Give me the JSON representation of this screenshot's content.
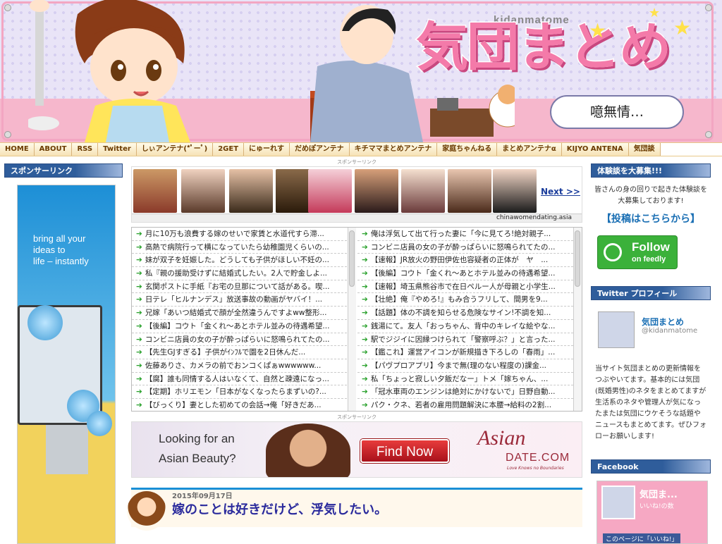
{
  "header": {
    "logo_sub": "kidanmatome",
    "logo_main": "気団まとめ",
    "speech": "噫無情…"
  },
  "nav": [
    "HOME",
    "ABOUT",
    "RSS",
    "Twitter",
    "しぃアンテナ(*ﾟーﾟ)",
    "2GET",
    "にゅーれす",
    "だめぽアンテナ",
    "キチママまとめアンテナ",
    "家庭ちゃんねる",
    "まとめアンテナα",
    "KIJYO ANTENA",
    "気団談"
  ],
  "left": {
    "sponsor_head": "スポンサーリンク",
    "ad_headline": [
      "bring all your",
      "ideas to",
      "life – instantly"
    ]
  },
  "center": {
    "sponsor_top": "スポンサーリンク",
    "next_label": "Next >>",
    "photo_ad_domain": "chinawomendating.asia",
    "links_left": [
      "月に10万も浪費する嫁のせいで家賃と水道代すら滞...",
      "高熱で病院行って横になっていたら幼稚園児くらいの...",
      "妹が双子を妊娠した。どうしても子供がほしい不妊の...",
      "私『親の援助受けずに結婚式したい。2人で貯金しよ...",
      "玄関ポストに手紙『お宅の旦那について話がある。喫...",
      "日テレ「ヒルナンデス」放送事故の動画がヤバイ！...",
      "兄嫁「あいつ結婚式で顔が全然違うんですよww整形...",
      "【後編】コウト「金くれ～あとホテル並みの待遇希望...",
      "コンビニ店員の女の子が酔っぱらいに怒鳴られてたの...",
      "【先生GJすぎる】子供がｲﾝﾌﾙで園を2日休んだ...",
      "佐藤ありさ、カメラの前でおンコくぱぁwwwwww...",
      "【腐】誰も同情する人はいなくて、自然と疎遠になっ...",
      "【定期】ホリエモン「日本がなくなったらまずいの?...",
      "【びっくり】妻とした初めての会話→俺「好きだあ..."
    ],
    "links_right": [
      "俺は浮気して出て行った妻に「今に見てろ!絶対親子...",
      "コンビニ店員の女の子が酔っぱらいに怒鳴られてたの...",
      "【速報】JR放火の野田伊佐也容疑者の正体が　ヤ　...",
      "【後編】コウト「金くれ～あとホテル並みの待遇希望...",
      "【速報】埼玉県熊谷市で在日ペルー人が母親と小学生...",
      "【壮絶】俺『やめろ!』もみ合うフリして、間男を9...",
      "【話題】体の不調を知らせる危険なサイン!不調を知...",
      "銭湯にて。友人「おっちゃん、背中のキレイな絵やな...",
      "駅でジジイに因縁つけられて「警察呼ぶ？」と言った...",
      "【鑑これ】運営アイコンが新規描き下ろしの「春雨」...",
      "【パヴプロアプリ】今まで無(理のない程度の)課金...",
      "私「ちょっと寂しい夕飯だなー」トメ「嫁ちゃん、...",
      "「冠水車両のエンジンは絶対にかけないで」日野自動...",
      "パク・クネ、若者の雇用問題解決に本腰→給料の2割..."
    ],
    "sponsor_bottom": "スポンサーリンク",
    "asian_ad": {
      "tagline_1": "Looking for an",
      "tagline_2": "Asian Beauty?",
      "cta": "Find Now",
      "brand_1": "Asian",
      "brand_2": "DATE.COM",
      "brand_3": "Love Knows no Boundaries"
    },
    "article": {
      "date": "2015年09月17日",
      "title": "嫁のことは好きだけど、浮気したい。"
    }
  },
  "right": {
    "recruit_head": "体験談を大募集!!!",
    "recruit_text": "皆さんの身の回りで起きた体験談を大募集しております!",
    "submit_link": "【投稿はこちらから】",
    "feedly_1": "Follow",
    "feedly_2": "on feedly",
    "twitter_head": "Twitter プロフィール",
    "tw_name": "気団まとめ",
    "tw_handle": "@kidanmatome",
    "tw_desc": "当サイト気団まとめの更新情報をつぶやいてます。基本的には気団(既婚男性)のネタをまとめてますが生活系のネタや管理人が気になったまたは気団にウケそうな話題やニュースもまとめてます。ぜひフォローお願いします!",
    "facebook_head": "Facebook",
    "fb_name": "気団ま...",
    "fb_likes": "いいね!の数",
    "fb_like": "このページに「いいね!」"
  },
  "colors": {
    "accent_blue": "#2f5d9b",
    "link_blue": "#2a2a9c",
    "pink": "#f47aa9",
    "feedly_green": "#3bb13a"
  }
}
